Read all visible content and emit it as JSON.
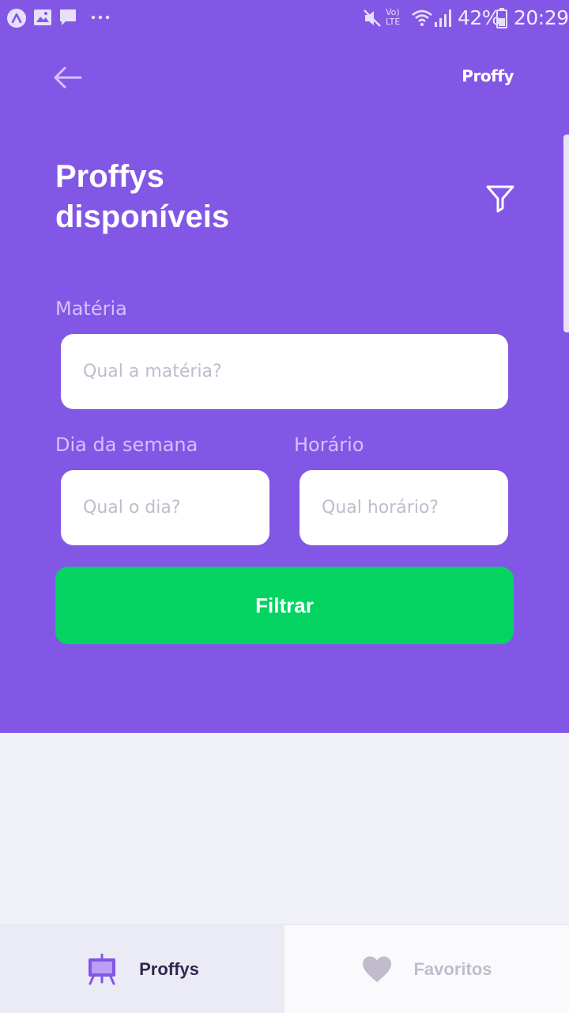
{
  "status_bar": {
    "battery": "42%",
    "time": "20:29",
    "network": "Vo) LTE"
  },
  "header": {
    "brand": "Proffy",
    "title_line1": "Proffys",
    "title_line2": "disponíveis"
  },
  "form": {
    "subject": {
      "label": "Matéria",
      "placeholder": "Qual a matéria?"
    },
    "week_day": {
      "label": "Dia da semana",
      "placeholder": "Qual o dia?"
    },
    "time": {
      "label": "Horário",
      "placeholder": "Qual horário?"
    },
    "submit_label": "Filtrar"
  },
  "tabs": [
    {
      "label": "Proffys",
      "icon": "easel-icon",
      "active": true
    },
    {
      "label": "Favoritos",
      "icon": "heart-icon",
      "active": false
    }
  ],
  "colors": {
    "primary": "#8257e5",
    "secondary": "#04d361",
    "background": "#f0f0f7",
    "label": "#d4c2ff",
    "active_tab_text": "#32264d",
    "inactive_tab_text": "#c1bccc"
  }
}
